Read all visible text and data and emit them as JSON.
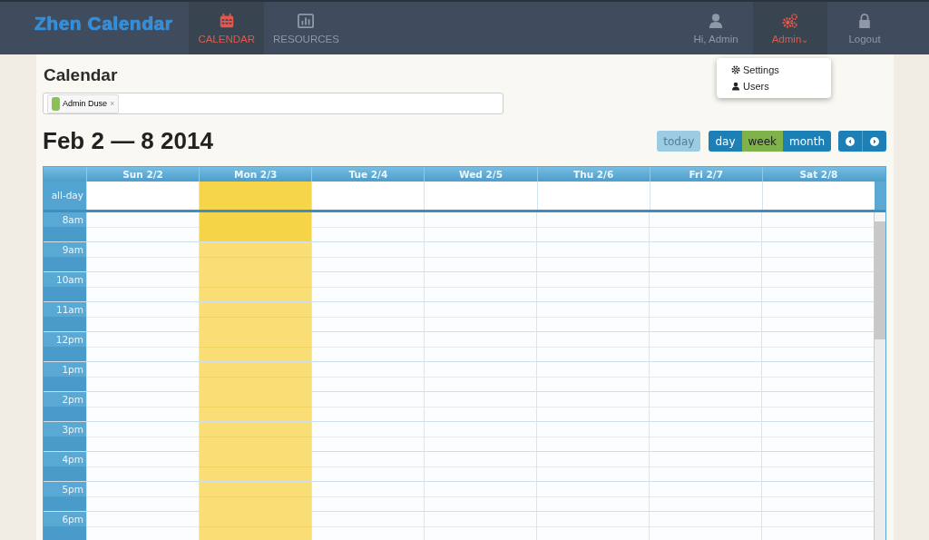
{
  "app_title": "Zhen Calendar",
  "nav": [
    {
      "label": "CALENDAR",
      "selected": true
    },
    {
      "label": "RESOURCES",
      "selected": false
    }
  ],
  "user_nav": [
    {
      "label": "Hi, Admin",
      "selected": false
    },
    {
      "label": "Admin",
      "selected": true,
      "caret": "⌄"
    },
    {
      "label": "Logout",
      "selected": false
    }
  ],
  "dropdown": [
    {
      "label": "Settings"
    },
    {
      "label": "Users"
    }
  ],
  "page_title": "Calendar",
  "filter": {
    "chips": [
      {
        "label": "Admin Duse",
        "color": "#8bc152",
        "remove": "×"
      }
    ]
  },
  "range_title": "Feb 2 — 8 2014",
  "today_button": {
    "label": "today",
    "disabled": true
  },
  "views": [
    {
      "label": "day",
      "selected": false
    },
    {
      "label": "week",
      "selected": true
    },
    {
      "label": "month",
      "selected": false
    }
  ],
  "calendar": {
    "allday_label": "all-day",
    "days": [
      {
        "label": "Sun 2/2",
        "today": false
      },
      {
        "label": "Mon 2/3",
        "today": true
      },
      {
        "label": "Tue 2/4",
        "today": false
      },
      {
        "label": "Wed 2/5",
        "today": false
      },
      {
        "label": "Thu 2/6",
        "today": false
      },
      {
        "label": "Fri 2/7",
        "today": false
      },
      {
        "label": "Sat 2/8",
        "today": false
      }
    ],
    "hours": [
      "8am",
      "9am",
      "10am",
      "11am",
      "12pm",
      "1pm",
      "2pm",
      "3pm",
      "4pm",
      "5pm",
      "6pm"
    ]
  }
}
